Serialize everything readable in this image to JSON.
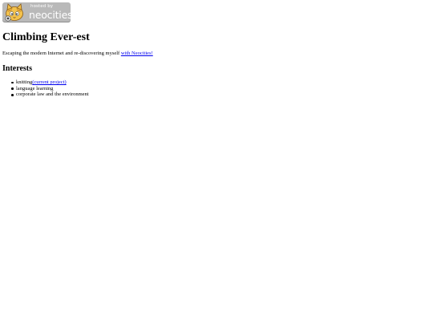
{
  "badge": {
    "hosted_by": "hosted by",
    "name": "neocities",
    "icon": "neocities-cat-icon"
  },
  "page": {
    "title": "Climbing Ever-est",
    "tagline_text": "Escaping the modern Internet and re-discovering myself ",
    "tagline_link": "with Neocities!"
  },
  "interests": {
    "heading": "Interests",
    "items": [
      {
        "text": "knitting",
        "link": "(current project)"
      },
      {
        "text": "language learning"
      },
      {
        "text": "corporate law and the environment"
      }
    ]
  },
  "colors": {
    "link": "#0000ee",
    "badge_background": "#b9b9b9",
    "badge_text": "#ffffff"
  }
}
